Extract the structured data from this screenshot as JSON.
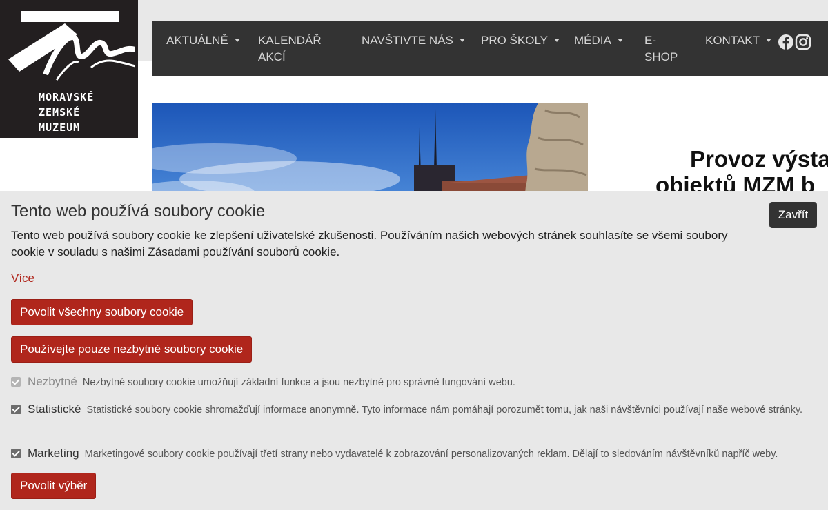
{
  "logo": {
    "line1": "MORAVSKÉ",
    "line2": "ZEMSKÉ",
    "line3": "MUZEUM"
  },
  "nav": {
    "items": [
      {
        "label": "AKTUÁLNĚ",
        "dropdown": true
      },
      {
        "label_line1": "KALENDÁŘ",
        "label_line2": "AKCÍ",
        "dropdown": false
      },
      {
        "label": "NAVŠTIVTE NÁS",
        "dropdown": true
      },
      {
        "label": "PRO ŠKOLY",
        "dropdown": true
      },
      {
        "label": "MÉDIA",
        "dropdown": true
      },
      {
        "label_line1": "E-",
        "label_line2": "SHOP",
        "dropdown": false
      },
      {
        "label": "KONTAKT",
        "dropdown": true
      }
    ],
    "social": [
      "facebook-icon",
      "instagram-icon"
    ]
  },
  "headline": {
    "line1": "Provoz výsta",
    "line2": "objektů MZM b"
  },
  "cookie": {
    "title": "Tento web používá soubory cookie",
    "close_label": "Zavřít",
    "description": "Tento web používá soubory cookie ke zlepšení uživatelské zkušenosti. Používáním našich webových stránek souhlasíte se všemi soubory cookie v souladu s našimi Zásadami používání souborů cookie.",
    "more_label": "Více",
    "allow_all_label": "Povolit všechny soubory cookie",
    "necessary_only_label": "Používejte pouze nezbytné soubory cookie",
    "options": [
      {
        "name": "Nezbytné",
        "text": "Nezbytné soubory cookie umožňují základní funkce a jsou nezbytné pro správné fungování webu.",
        "checked": true,
        "disabled": true
      },
      {
        "name": "Statistické",
        "text": "Statistické soubory cookie shromažďují informace anonymně. Tyto informace nám pomáhají porozumět tomu, jak naši návštěvníci používají naše webové stránky.",
        "checked": true,
        "disabled": false
      },
      {
        "name": "Marketing",
        "text": "Marketingové soubory cookie používají třetí strany nebo vydavatelé k zobrazování personalizovaných reklam. Dělají to sledováním návštěvníků napříč weby.",
        "checked": true,
        "disabled": false
      }
    ],
    "allow_selection_label": "Povolit výběr"
  },
  "colors": {
    "nav_bg": "#333333",
    "accent_red": "#b0261c",
    "cookie_bg": "#e8e8e8",
    "logo_bg": "#231f20"
  }
}
